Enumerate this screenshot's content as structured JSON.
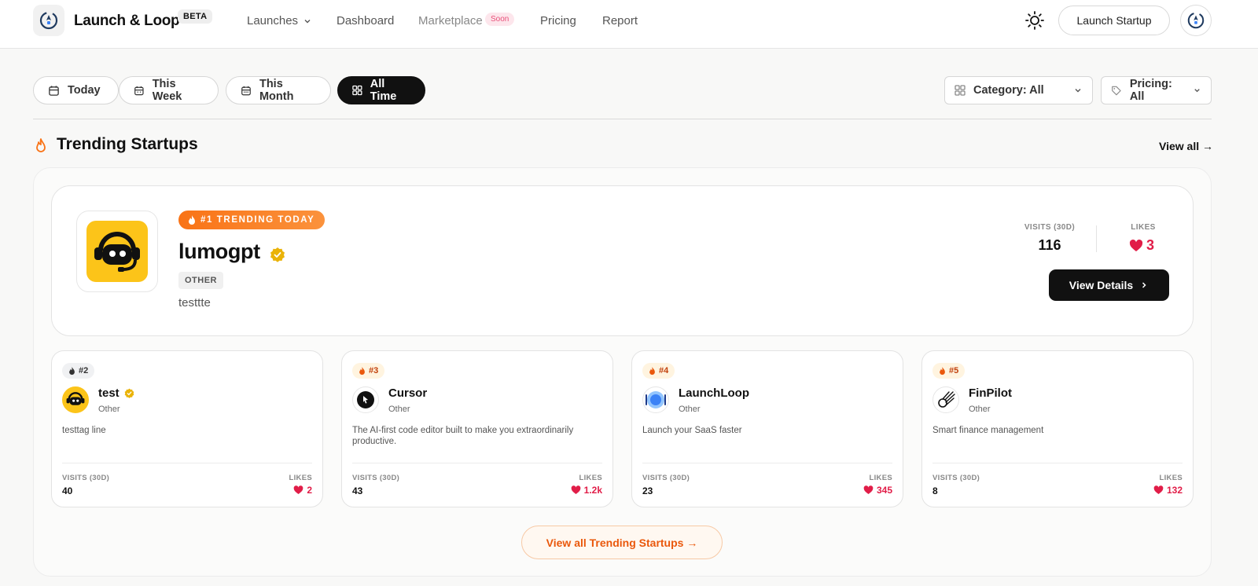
{
  "header": {
    "brand": "Launch & Loop",
    "beta": "BETA",
    "nav": {
      "launches": "Launches",
      "dashboard": "Dashboard",
      "marketplace": "Marketplace",
      "soon": "Soon",
      "pricing": "Pricing",
      "report": "Report"
    },
    "launch_button": "Launch Startup"
  },
  "filters": {
    "today": "Today",
    "this_week": "This Week",
    "this_month": "This Month",
    "all_time": "All Time",
    "active": "all_time",
    "category": "Category: All",
    "pricing": "Pricing: All"
  },
  "section": {
    "title": "Trending Startups",
    "view_all": "View all →",
    "view_all_button": "View all Trending Startups →"
  },
  "featured": {
    "badge": "#1 TRENDING TODAY",
    "name": "lumogpt",
    "category": "OTHER",
    "tagline": "testtte",
    "visits_label": "VISITS (30D)",
    "visits": "116",
    "likes_label": "LIKES",
    "likes": "3",
    "button": "View Details"
  },
  "cards": [
    {
      "rank": "#2",
      "name": "test",
      "category": "Other",
      "desc": "testtag line",
      "visits_label": "VISITS (30D)",
      "visits": "40",
      "likes_label": "LIKES",
      "likes": "2"
    },
    {
      "rank": "#3",
      "name": "Cursor",
      "category": "Other",
      "desc": "The AI-first code editor built to make you extraordinarily productive.",
      "visits_label": "VISITS (30D)",
      "visits": "43",
      "likes_label": "LIKES",
      "likes": "1.2k"
    },
    {
      "rank": "#4",
      "name": "LaunchLoop",
      "category": "Other",
      "desc": "Launch your SaaS faster",
      "visits_label": "VISITS (30D)",
      "visits": "23",
      "likes_label": "LIKES",
      "likes": "345"
    },
    {
      "rank": "#5",
      "name": "FinPilot",
      "category": "Other",
      "desc": "Smart finance management",
      "visits_label": "VISITS (30D)",
      "visits": "8",
      "likes_label": "LIKES",
      "likes": "132"
    }
  ],
  "icons": {
    "logo": "rocket-loop-icon",
    "theme": "sun-icon",
    "flame": "flame-icon",
    "heart": "heart-icon",
    "verified": "verified-badge-icon"
  },
  "colors": {
    "accent_orange": "#f97316",
    "like_red": "#e11d48",
    "verified_gold": "#eab308",
    "dark": "#111111"
  }
}
